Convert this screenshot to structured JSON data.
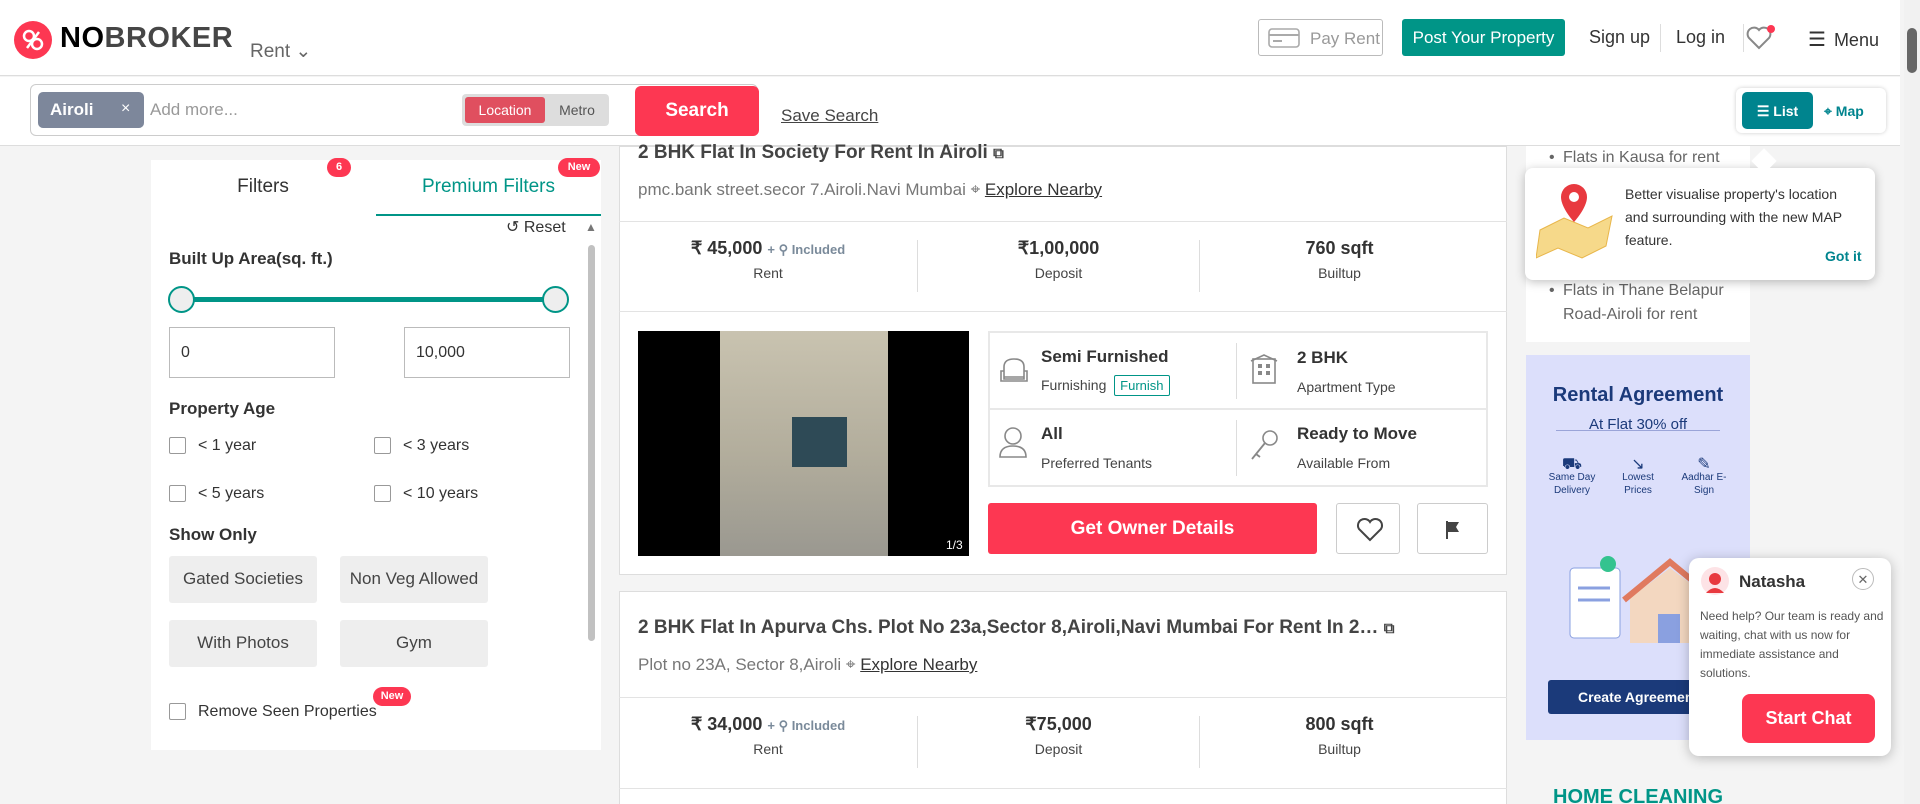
{
  "header": {
    "logo_no": "NO",
    "logo_broker": "BROKER",
    "rent_dropdown": "Rent",
    "pay_rent": "Pay Rent",
    "post_property": "Post Your Property",
    "sign_up": "Sign up",
    "log_in": "Log in",
    "menu": "Menu"
  },
  "search": {
    "chip": "Airoli",
    "chip_close": "×",
    "placeholder": "Add more...",
    "toggle_location": "Location",
    "toggle_metro": "Metro",
    "button": "Search",
    "save_search": "Save Search",
    "view_list": "List",
    "view_map": "Map"
  },
  "filters": {
    "tab_filters": "Filters",
    "filters_count": "6",
    "tab_premium": "Premium Filters",
    "premium_badge": "New",
    "reset": "Reset",
    "built_up_title": "Built Up Area(sq. ft.)",
    "min_area": "0",
    "max_area": "10,000",
    "age_title": "Property Age",
    "age_options": [
      "< 1 year",
      "< 3 years",
      "< 5 years",
      "< 10 years"
    ],
    "show_only_title": "Show Only",
    "show_only": [
      "Gated Societies",
      "Non Veg Allowed",
      "With Photos",
      "Gym"
    ],
    "remove_seen": "Remove Seen Properties",
    "remove_seen_badge": "New"
  },
  "listings": [
    {
      "title": "2 BHK Flat In Society For Rent In Airoli",
      "address": "pmc.bank street.secor 7.Airoli.Navi Mumbai",
      "explore": "Explore Nearby",
      "rent": "₹ 45,000",
      "rent_extra": "+ ⚲ Included",
      "rent_label": "Rent",
      "deposit": "₹1,00,000",
      "deposit_label": "Deposit",
      "builtup": "760 sqft",
      "builtup_label": "Builtup",
      "photo_count": "1/3",
      "furnishing": "Semi Furnished",
      "furnishing_label": "Furnishing",
      "furnish_tag": "Furnish",
      "apartment": "2 BHK",
      "apartment_label": "Apartment Type",
      "tenants": "All",
      "tenants_label": "Preferred Tenants",
      "available": "Ready to Move",
      "available_label": "Available From",
      "owner_button": "Get Owner Details"
    },
    {
      "title": "2 BHK Flat In Apurva Chs. Plot No 23a,Sector 8,Airoli,Navi Mumbai For Rent In 2…",
      "address": "Plot no 23A, Sector 8,Airoli",
      "explore": "Explore Nearby",
      "rent": "₹ 34,000",
      "rent_extra": "+ ⚲ Included",
      "rent_label": "Rent",
      "deposit": "₹75,000",
      "deposit_label": "Deposit",
      "builtup": "800 sqft",
      "builtup_label": "Builtup"
    }
  ],
  "sidebar": {
    "links": [
      "Flats in Kausa for rent",
      "Flats in Thane Belapur Road-Airoli for rent"
    ],
    "tooltip_text": "Better visualise property's location and surrounding with the new MAP feature.",
    "got_it": "Got it",
    "ad_title": "Rental Agreement",
    "ad_subtitle": "At Flat 30% off",
    "ad_features": [
      "Same Day Delivery",
      "Lowest Prices",
      "Aadhar E-Sign"
    ],
    "ad_button": "Create Agreement",
    "home_cleaning": "HOME CLEANING"
  },
  "chat": {
    "name": "Natasha",
    "message": "Need help? Our team is ready and waiting, chat with us now for immediate assistance and solutions.",
    "button": "Start Chat"
  },
  "colors": {
    "brand": "#fd3752",
    "teal": "#009587",
    "map_teal": "#00848e"
  }
}
